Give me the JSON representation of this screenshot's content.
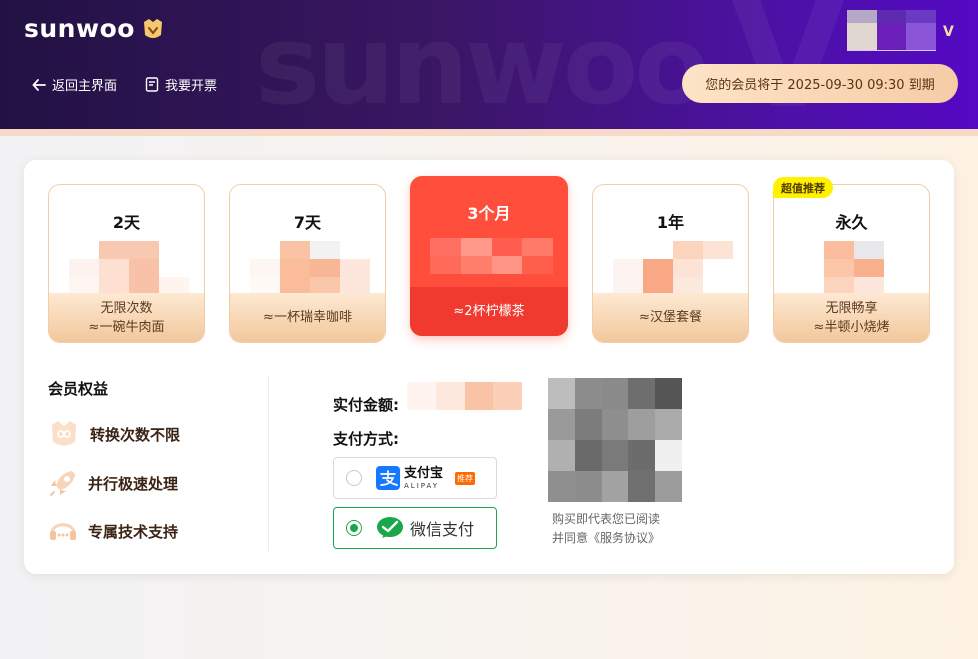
{
  "brand": {
    "name": "sunwoo",
    "watermark": "sunwoo"
  },
  "nav": {
    "back_label": "返回主界面",
    "invoice_label": "我要开票"
  },
  "account": {
    "vip_badge": "V"
  },
  "membership": {
    "expiry_text": "您的会员将于 2025-09-30 09:30 到期"
  },
  "plans": [
    {
      "name": "2天",
      "desc_line1": "无限次数",
      "desc_line2": "≈一碗牛肉面",
      "selected": false
    },
    {
      "name": "7天",
      "desc_line1": "≈一杯瑞幸咖啡",
      "desc_line2": "",
      "selected": false
    },
    {
      "name": "3个月",
      "desc_line1": "≈2杯柠檬茶",
      "desc_line2": "",
      "selected": true
    },
    {
      "name": "1年",
      "desc_line1": "≈汉堡套餐",
      "desc_line2": "",
      "selected": false
    },
    {
      "name": "永久",
      "desc_line1": "无限畅享",
      "desc_line2": "≈半顿小烧烤",
      "selected": false,
      "badge": "超值推荐"
    }
  ],
  "benefits": {
    "title": "会员权益",
    "items": [
      {
        "label": "转换次数不限",
        "icon": "infinity-icon"
      },
      {
        "label": "并行极速处理",
        "icon": "rocket-icon"
      },
      {
        "label": "专属技术支持",
        "icon": "headset-icon"
      }
    ]
  },
  "payment": {
    "amount_label": "实付金额:",
    "method_label": "支付方式:",
    "methods": [
      {
        "name_cn": "支付宝",
        "name_en": "ALIPAY",
        "tag": "推荐",
        "selected": false
      },
      {
        "name_cn": "微信支付",
        "selected": true
      }
    ]
  },
  "agreement": {
    "line1": "购买即代表您已阅读",
    "line2": "并同意《服务协议》"
  },
  "colors": {
    "header_start": "#221243",
    "header_end": "#5509c4",
    "accent_red": "#ff4e3c",
    "wechat_green": "#1aa74a",
    "alipay_blue": "#1677ff"
  }
}
